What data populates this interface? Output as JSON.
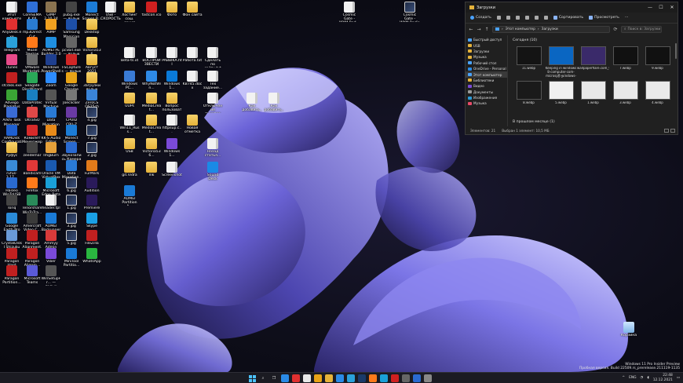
{
  "desktop": {
    "icons": [
      {
        "label": "Этот компьютер",
        "kind": "file",
        "color": "#4aa3ff"
      },
      {
        "label": "CoreSEMAK XX",
        "kind": "app",
        "color": "#2f6fd6"
      },
      {
        "label": "GIMP 2.10.24",
        "kind": "app",
        "color": "#8a7350"
      },
      {
        "label": "pubg.exe — ярлык",
        "kind": "app",
        "color": "#444"
      },
      {
        "label": "Monect Screen R...",
        "kind": "app",
        "color": "#1c7cd6"
      },
      {
        "label": "USB - СКОРОСТЬ",
        "kind": "file",
        "color": "#f2f2f2"
      },
      {
        "label": "Хостинг сош. сения",
        "kind": "folder",
        "color": "#e5b23a"
      },
      {
        "label": "fastcon.ico",
        "kind": "app",
        "color": "#d02020"
      },
      {
        "label": "Фото",
        "kind": "folder",
        "color": "#e5b23a"
      },
      {
        "label": "Фон сайта",
        "kind": "folder",
        "color": "#e5b23a"
      },
      {
        "label": "AnyDesk.exe",
        "kind": "app",
        "color": "#e03030"
      },
      {
        "label": "mp3DirectCut",
        "kind": "app",
        "color": "#2a7bd0"
      },
      {
        "label": "AIMP",
        "kind": "app",
        "color": "#f0a020"
      },
      {
        "label": "Samsung Magician",
        "kind": "app",
        "color": "#1d4fa8"
      },
      {
        "label": "Desktop",
        "kind": "folder",
        "color": "#e5b23a"
      },
      {
        "label": "Telegram",
        "kind": "app",
        "color": "#2aa1da"
      },
      {
        "label": "Mozill Звиток",
        "kind": "app",
        "color": "#ff7a1a"
      },
      {
        "label": "AOMEI PE Builder 2.0",
        "kind": "app",
        "color": "#1f8fe0"
      },
      {
        "label": "pcvbit.exe — ярлык",
        "kind": "app",
        "color": "#666"
      },
      {
        "label": "Victoria536",
        "kind": "folder",
        "color": "#e5b23a"
      },
      {
        "label": "Beta-ts.id",
        "kind": "file",
        "color": "#f2f2f2"
      },
      {
        "label": "ВОСПРОИЗВЕСТИ",
        "kind": "file",
        "color": "#f2f2f2"
      },
      {
        "label": "PABBIKA.htl",
        "kind": "file",
        "color": "#f2f2f2"
      },
      {
        "label": "Работа.txt",
        "kind": "file",
        "color": "#f2f2f2"
      },
      {
        "label": "Сделать по сайту.txt",
        "kind": "file",
        "color": "#f2f2f2"
      },
      {
        "label": "iTunes",
        "kind": "app",
        "color": "#e84a8a"
      },
      {
        "label": "VMware Workstati...",
        "kind": "app",
        "color": "#6b6b6b"
      },
      {
        "label": "Windows PowerShell",
        "kind": "app",
        "color": "#1f3f8f"
      },
      {
        "label": "FSCaptures — ярлык",
        "kind": "app",
        "color": "#d02626"
      },
      {
        "label": "Август 2021",
        "kind": "folder",
        "color": "#e5b23a"
      },
      {
        "label": "Windows PC...",
        "kind": "app",
        "color": "#3a7bd5"
      },
      {
        "label": "WhyNotWin...",
        "kind": "app",
        "color": "#2e8ae6"
      },
      {
        "label": "Windows 1...",
        "kind": "app",
        "color": "#0a7ad8"
      },
      {
        "label": "KB745.docx",
        "kind": "file",
        "color": "#2b5fb4"
      },
      {
        "label": "Тех задание...",
        "kind": "file",
        "color": "#f2f2f2"
      },
      {
        "label": "sfcdisk.exe",
        "kind": "app",
        "color": "#c02020"
      },
      {
        "label": "Seagate DiscWizard",
        "kind": "app",
        "color": "#2aa858"
      },
      {
        "label": "Zoom",
        "kind": "app",
        "color": "#2d8cff"
      },
      {
        "label": "Google Chrome",
        "kind": "app",
        "color": "#e8a317"
      },
      {
        "label": "Загрузки ярлык",
        "kind": "folder",
        "color": "#e5b23a"
      },
      {
        "label": "UUPs",
        "kind": "folder",
        "color": "#e5b23a"
      },
      {
        "label": "MediaCreat...",
        "kind": "folder",
        "color": "#e5b23a"
      },
      {
        "label": "Вопрос пользовате...",
        "kind": "folder",
        "color": "#e5b23a"
      },
      {
        "label": "Отключение пунктов в...",
        "kind": "file",
        "color": "#f2f2f2"
      },
      {
        "label": "Как добавить...",
        "kind": "file",
        "color": "#f2f2f2"
      },
      {
        "label": "Как добавить...",
        "kind": "file",
        "color": "#f2f2f2"
      },
      {
        "label": "Advego Plagiatus",
        "kind": "app",
        "color": "#3aa335"
      },
      {
        "label": "DataProtect",
        "kind": "app",
        "color": "#1a7fc0"
      },
      {
        "label": "Virtual Machine U...",
        "kind": "app",
        "color": "#555"
      },
      {
        "label": "Joeclicker",
        "kind": "app",
        "color": "#777"
      },
      {
        "label": "ZeroCS OS25ch 1.0",
        "kind": "app",
        "color": "#3a84d8"
      },
      {
        "label": "Win11_Russ...",
        "kind": "file",
        "color": "#f2f2f2"
      },
      {
        "label": "MediaCreat...",
        "kind": "folder",
        "color": "#e5b23a"
      },
      {
        "label": "httpsup.c...",
        "kind": "file",
        "color": "#f2f2f2"
      },
      {
        "label": "Новая отметка",
        "kind": "folder",
        "color": "#e5b23a"
      },
      {
        "label": "Arkhi Task Manager",
        "kind": "app",
        "color": "#3a6bd5"
      },
      {
        "label": "UltraISO",
        "kind": "app",
        "color": "#e04848"
      },
      {
        "label": "Data Migration",
        "kind": "app",
        "color": "#2a7ad5"
      },
      {
        "label": "CPUID CPU-Z",
        "kind": "app",
        "color": "#6a3aa3"
      },
      {
        "label": "4.jpg",
        "kind": "img",
        "color": "#333"
      },
      {
        "label": "USB",
        "kind": "folder",
        "color": "#e5b23a"
      },
      {
        "label": "Victoria536...",
        "kind": "folder",
        "color": "#e5b23a"
      },
      {
        "label": "Windows 1...",
        "kind": "app",
        "color": "#7a4ad8"
      },
      {
        "label": "Назад статья...",
        "kind": "file",
        "color": "#f2f2f2"
      },
      {
        "label": "RAMDisk Configurati...",
        "kind": "app",
        "color": "#1e5fd0"
      },
      {
        "label": "Комилет Менеджер",
        "kind": "app",
        "color": "#d62a2a"
      },
      {
        "label": "KK-S Audio Editor",
        "kind": "app",
        "color": "#e88a1a"
      },
      {
        "label": "Monect Screen...",
        "kind": "app",
        "color": "#1c7cd6"
      },
      {
        "label": "7.jpg",
        "kind": "img",
        "color": "#333"
      },
      {
        "label": "Руфус",
        "kind": "folder",
        "color": "#e5b23a"
      },
      {
        "label": "git.Vidra",
        "kind": "folder",
        "color": "#e5b23a"
      },
      {
        "label": "lnk",
        "kind": "folder",
        "color": "#e5b23a"
      },
      {
        "label": "Screenshot",
        "kind": "file",
        "color": "#f2f2f2"
      },
      {
        "label": "Sound Deck",
        "kind": "app",
        "color": "#1a8ae6"
      },
      {
        "label": "zeedemar",
        "kind": "app",
        "color": "#444"
      },
      {
        "label": "ImgBurn",
        "kind": "app",
        "color": "#e5a03a"
      },
      {
        "label": "Звукозапись Камера",
        "kind": "app",
        "color": "#2a6ad0"
      },
      {
        "label": "2.jpg",
        "kind": "img",
        "color": "#333"
      },
      {
        "label": "rufus-3.17...",
        "kind": "app",
        "color": "#3a8ad6"
      },
      {
        "label": "AOMEI Partition A...",
        "kind": "app",
        "color": "#1a7ad6"
      },
      {
        "label": "Bandicam",
        "kind": "app",
        "color": "#e03838"
      },
      {
        "label": "Oracle VM VirtualBox",
        "kind": "app",
        "color": "#1a5ab0"
      },
      {
        "label": "Data Migration...",
        "kind": "app",
        "color": "#2a7ad5"
      },
      {
        "label": "FurMark",
        "kind": "app",
        "color": "#e07a1a"
      },
      {
        "label": "Hasleo WinToUSB",
        "kind": "app",
        "color": "#2a6ad0"
      },
      {
        "label": "Firefox",
        "kind": "app",
        "color": "#ff7a1a"
      },
      {
        "label": "Microsoft Edge Beta",
        "kind": "app",
        "color": "#1aa0d8"
      },
      {
        "label": "6.jpg",
        "kind": "img",
        "color": "#333"
      },
      {
        "label": "Audition",
        "kind": "app",
        "color": "#2a1a5a"
      },
      {
        "label": "Toriq",
        "kind": "app",
        "color": "#444"
      },
      {
        "label": "Tenorshare WinToTra...",
        "kind": "app",
        "color": "#2a8a5a"
      },
      {
        "label": "header.tpl",
        "kind": "file",
        "color": "#f2f2f2"
      },
      {
        "label": "1.jpg",
        "kind": "img",
        "color": "#333"
      },
      {
        "label": "Premiere",
        "kind": "app",
        "color": "#2a1a5a"
      },
      {
        "label": "Google Earth Pro",
        "kind": "app",
        "color": "#2a8ad8"
      },
      {
        "label": "Amercraft Video C...",
        "kind": "app",
        "color": "#3a3a3a"
      },
      {
        "label": "AOMEI Backupper",
        "kind": "app",
        "color": "#1a7ad6"
      },
      {
        "label": "3.jpg",
        "kind": "img",
        "color": "#333"
      },
      {
        "label": "Skype",
        "kind": "app",
        "color": "#1aa0e6"
      },
      {
        "label": "CrystalDiskI Shizuku Editi...",
        "kind": "app",
        "color": "#6a9ad8"
      },
      {
        "label": "Paragon Alignment...",
        "kind": "app",
        "color": "#c02020"
      },
      {
        "label": "Ammyy Admin 3.4...",
        "kind": "app",
        "color": "#d83a3a"
      },
      {
        "label": "5.jpg",
        "kind": "img",
        "color": "#333"
      },
      {
        "label": "FileZilla",
        "kind": "app",
        "color": "#c02020"
      },
      {
        "label": "Paragon Hard Disk...",
        "kind": "app",
        "color": "#c02020"
      },
      {
        "label": "Paragon Alignm...",
        "kind": "app",
        "color": "#c02020"
      },
      {
        "label": "Viber",
        "kind": "app",
        "color": "#7a4ad8"
      },
      {
        "label": "MiniTool Partitio...",
        "kind": "app",
        "color": "#1a7ad6"
      },
      {
        "label": "WhatsApp",
        "kind": "app",
        "color": "#2ab540"
      },
      {
        "label": "Paragon Partition...",
        "kind": "app",
        "color": "#c02020"
      },
      {
        "label": "Microsoft Teams",
        "kind": "app",
        "color": "#5a5ad8"
      },
      {
        "label": "WinSetupFr... — ярлык",
        "kind": "app",
        "color": "#555"
      },
      {
        "label": "Cosmic Gate - WYM Rad...",
        "kind": "file",
        "color": "#3a3a3a"
      },
      {
        "label": "Cosmic Gate - WYM Radio 2021...",
        "kind": "img",
        "color": "#6a5a4a"
      },
      {
        "label": "Корзина",
        "kind": "trash",
        "color": "#9cc8f0"
      }
    ]
  },
  "explorer": {
    "title": "Загрузки",
    "window_buttons": {
      "minimize": "—",
      "maximize": "☐",
      "close": "✕"
    },
    "toolbar": {
      "create": "Создать",
      "sort": "Сортировать",
      "view": "Просмотреть",
      "more": "···"
    },
    "address": {
      "back": "←",
      "forward": "→",
      "up": "↑",
      "path": [
        "Этот компьютер",
        "Загрузки"
      ],
      "separator": "›",
      "search_placeholder": "Поиск в: Загрузки"
    },
    "nav": [
      {
        "label": "Быстрый доступ",
        "color": "#4aa3ff",
        "selected": false
      },
      {
        "label": "USB",
        "color": "#e5b23a",
        "selected": false
      },
      {
        "label": "Загрузки",
        "color": "#e5b23a",
        "selected": false
      },
      {
        "label": "Музыка",
        "color": "#e5b23a",
        "selected": false
      },
      {
        "label": "Рабочий стол",
        "color": "#4aa3ff",
        "selected": false
      },
      {
        "label": "OneDrive - Personal",
        "color": "#2a8ae6",
        "selected": false
      },
      {
        "label": "Этот компьютер",
        "color": "#4aa3ff",
        "selected": true
      },
      {
        "label": "Библиотеки",
        "color": "#e5b23a",
        "selected": false
      },
      {
        "label": "Видео",
        "color": "#7a4ad8",
        "selected": false
      },
      {
        "label": "Документы",
        "color": "#9a9a9a",
        "selected": false
      },
      {
        "label": "Изображения",
        "color": "#2a9ad8",
        "selected": false
      },
      {
        "label": "Музыка",
        "color": "#e84a6a",
        "selected": false
      }
    ],
    "group_today": "Сегодня (10)",
    "group_earlier": "В прошлом месяце (1)",
    "files": [
      {
        "name": "11.webp",
        "thumb": "#141414"
      },
      {
        "name": "Keeping in windows 8-computer-com-microsoft-windows-10-5...",
        "thumb": "#0a66c2"
      },
      {
        "name": "wallpaperflare.com_wallpaper.jpg",
        "thumb": "#3a2a6a"
      },
      {
        "name": "7.webp",
        "thumb": "#111111"
      },
      {
        "name": "9.webp",
        "thumb": "#111111"
      },
      {
        "name": "8.webp",
        "thumb": "#1a1a1a"
      },
      {
        "name": "5.webp",
        "thumb": "#f0f0f0"
      },
      {
        "name": "1.webp",
        "thumb": "#e8e8e8"
      },
      {
        "name": "3.webp",
        "thumb": "#e8e8e8"
      },
      {
        "name": "4.webp",
        "thumb": "#eaeaea"
      }
    ],
    "status": {
      "items": "Элементов: 21",
      "selected": "Выбран 1 элемент: 10,5 МБ"
    }
  },
  "watermark": {
    "line1": "Windows 11 Pro Insider Preview",
    "line2": "Пробная версия. Build 22509.rs_prerelease.211119-1135"
  },
  "taskbar": {
    "apps": [
      {
        "name": "start",
        "color": "#4cc2ff"
      },
      {
        "name": "search",
        "color": "#dddddd"
      },
      {
        "name": "task-view",
        "color": "#dddddd"
      },
      {
        "name": "widgets",
        "color": "#2a8ae6"
      },
      {
        "name": "opera",
        "color": "#e03030"
      },
      {
        "name": "yandex",
        "color": "#e8e8e8"
      },
      {
        "name": "chrome",
        "color": "#e8a317"
      },
      {
        "name": "file-explorer",
        "color": "#e5b23a"
      },
      {
        "name": "store",
        "color": "#2a8ae6"
      },
      {
        "name": "telegram",
        "color": "#2aa1da"
      },
      {
        "name": "photoshop",
        "color": "#1a3a6a"
      },
      {
        "name": "firefox",
        "color": "#ff7a1a"
      },
      {
        "name": "edge",
        "color": "#1aa0d8"
      },
      {
        "name": "app-red",
        "color": "#d02020"
      },
      {
        "name": "app-gray",
        "color": "#666666"
      },
      {
        "name": "app-blue",
        "color": "#2a6ad0"
      },
      {
        "name": "settings",
        "color": "#888888"
      }
    ],
    "lang": "ENG",
    "time": "22:48",
    "date": "12.12.2021",
    "chevron": "^"
  }
}
